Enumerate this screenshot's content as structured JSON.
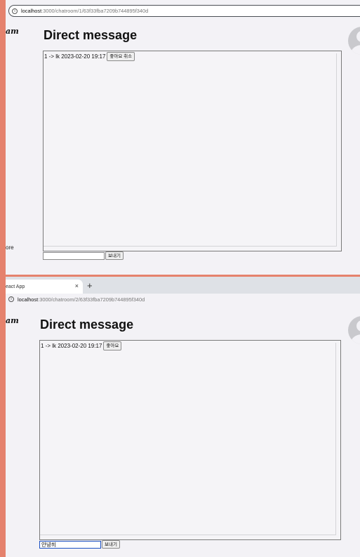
{
  "window1": {
    "url_host": "localhost",
    "url_path": ":3000/chatroom/1/63f33fba7209b744895f340d",
    "logo_text": "am",
    "sidebar_more": "ore",
    "title": "Direct message",
    "message": "1 -> lk 2023-02-20 19:17",
    "like_button": "좋아요 취소",
    "input_value": "",
    "send_button": "보내기"
  },
  "window2": {
    "tab_title": "eact App",
    "tab_close": "×",
    "new_tab": "+",
    "url_host": "localhost",
    "url_path": ":3000/chatroom/2/63f33fba7209b744895f340d",
    "logo_text": "am",
    "title": "Direct message",
    "message": "1 -> lk 2023-02-20 19:17",
    "like_button": "좋아요",
    "input_value": "안녕히",
    "send_button": "보내기"
  },
  "icons": {
    "info": "info-icon",
    "avatar": "user-avatar-icon"
  }
}
